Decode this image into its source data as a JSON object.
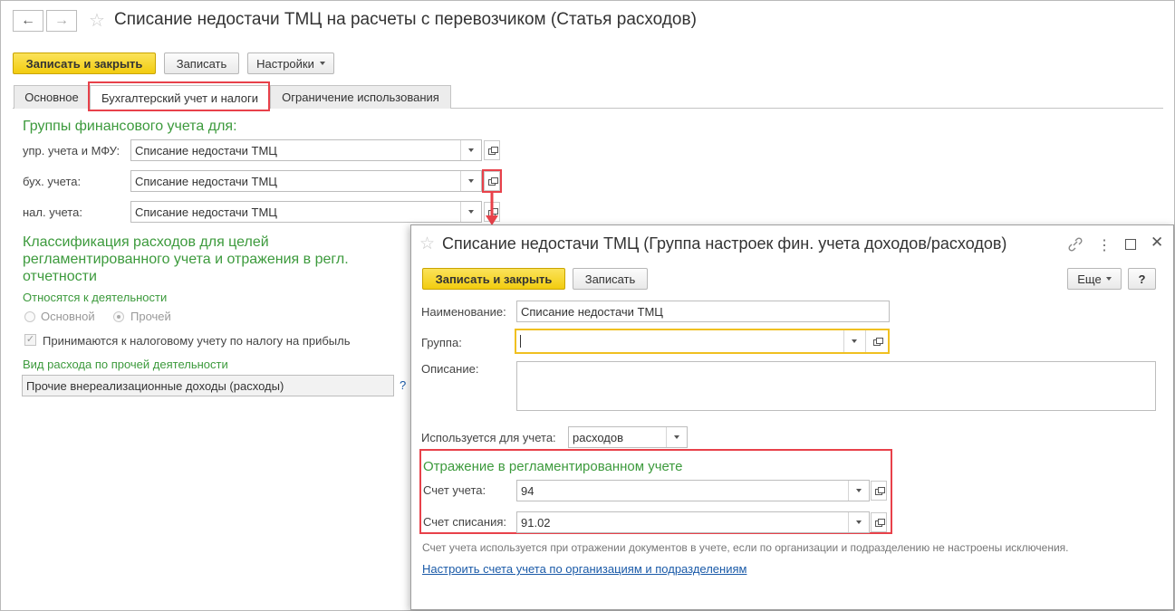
{
  "main": {
    "title": "Списание недостачи ТМЦ на расчеты с перевозчиком (Статья расходов)",
    "nav": {
      "back": "←",
      "forward": "→"
    },
    "toolbar": {
      "save_close": "Записать и закрыть",
      "save": "Записать",
      "settings": "Настройки"
    },
    "tabs": [
      {
        "label": "Основное"
      },
      {
        "label": "Бухгалтерский учет и налоги"
      },
      {
        "label": "Ограничение использования"
      }
    ],
    "fin_groups": {
      "heading": "Группы финансового учета для:",
      "rows": [
        {
          "label": "упр. учета и МФУ:",
          "value": "Списание недостачи ТМЦ"
        },
        {
          "label": "бух. учета:",
          "value": "Списание недостачи ТМЦ"
        },
        {
          "label": "нал. учета:",
          "value": "Списание недостачи ТМЦ"
        }
      ]
    },
    "classification": {
      "heading": "Классификация расходов для целей регламентированного учета и отражения в регл. отчетности",
      "activity_label": "Относятся к деятельности",
      "radio_main": "Основной",
      "radio_other": "Прочей",
      "tax_check": "Принимаются к налоговому учету по налогу на прибыль",
      "expense_type_label": "Вид расхода по прочей деятельности",
      "expense_type_value": "Прочие внереализационные доходы (расходы)",
      "help": "?"
    }
  },
  "dialog": {
    "title": "Списание недостачи ТМЦ (Группа настроек фин. учета доходов/расходов)",
    "toolbar": {
      "save_close": "Записать и закрыть",
      "save": "Записать",
      "more": "Еще",
      "help": "?"
    },
    "name_label": "Наименование:",
    "name_value": "Списание недостачи ТМЦ",
    "group_label": "Группа:",
    "group_value": "",
    "description_label": "Описание:",
    "used_for_label": "Используется для учета:",
    "used_for_value": "расходов",
    "regl": {
      "heading": "Отражение в регламентированном учете",
      "account_label": "Счет учета:",
      "account_value": "94",
      "writeoff_label": "Счет списания:",
      "writeoff_value": "91.02"
    },
    "note": "Счет учета используется при отражении документов в учете, если по организации и подразделению не настроены исключения.",
    "link": "Настроить счета учета по организациям и подразделениям"
  },
  "colors": {
    "accent_green": "#3c9a3c",
    "highlight_red": "#e8414a",
    "primary_yellow": "#f2cc0f",
    "link_blue": "#1a5aa8"
  }
}
